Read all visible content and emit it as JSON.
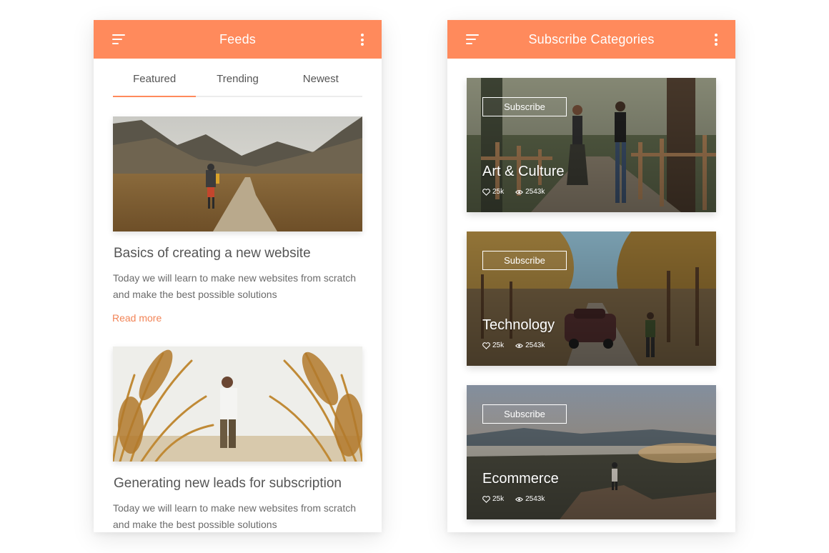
{
  "feeds_screen": {
    "title": "Feeds",
    "menu_icon": "menu-icon",
    "more_icon": "more-vertical-icon",
    "tabs": [
      {
        "label": "Featured",
        "active": true
      },
      {
        "label": "Trending",
        "active": false
      },
      {
        "label": "Newest",
        "active": false
      }
    ],
    "posts": [
      {
        "title": "Basics of creating a new website",
        "description": "Today we will learn to make new websites from scratch and make the best possible solutions",
        "read_more": "Read more"
      },
      {
        "title": "Generating new leads for subscription",
        "description": "Today we will learn to make new websites from scratch and make the best possible solutions"
      }
    ]
  },
  "subscribe_screen": {
    "title": "Subscribe Categories",
    "menu_icon": "menu-icon",
    "more_icon": "more-vertical-icon",
    "categories": [
      {
        "name": "Art & Culture",
        "button": "Subscribe",
        "likes": "25k",
        "views": "2543k"
      },
      {
        "name": "Technology",
        "button": "Subscribe",
        "likes": "25k",
        "views": "2543k"
      },
      {
        "name": "Ecommerce",
        "button": "Subscribe",
        "likes": "25k",
        "views": "2543k"
      }
    ]
  },
  "colors": {
    "accent": "#ff8a5c",
    "link": "#f28457",
    "text_primary": "#555555",
    "text_secondary": "#6b6b6b"
  }
}
